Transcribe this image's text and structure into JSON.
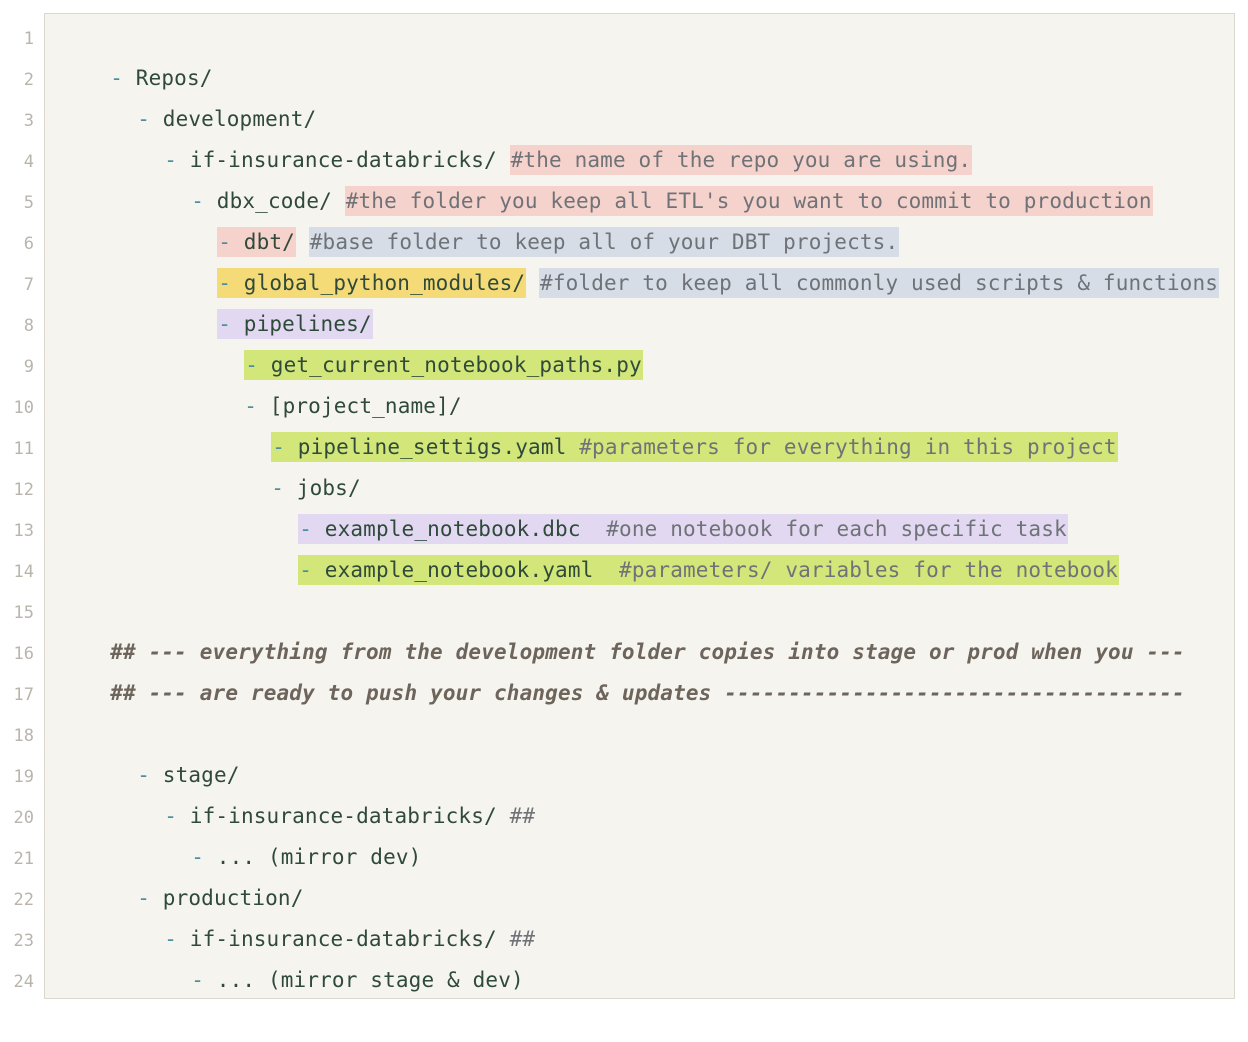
{
  "editor": {
    "line_numbers": [
      "1",
      "2",
      "3",
      "4",
      "5",
      "6",
      "7",
      "8",
      "9",
      "10",
      "11",
      "12",
      "13",
      "14",
      "15",
      "16",
      "17",
      "18",
      "19",
      "20",
      "21",
      "22",
      "23",
      "24"
    ],
    "lines": {
      "l1": {
        "dash": "- ",
        "text": "Repos/"
      },
      "l2": {
        "dash": "- ",
        "text": "development/"
      },
      "l3": {
        "dash": "- ",
        "text": "if-insurance-databricks/",
        "comment": "#the name of the repo you are using."
      },
      "l4": {
        "dash": "- ",
        "text": "dbx_code/",
        "comment": "#the folder you keep all ETL's you want to commit to production"
      },
      "l5": {
        "dash": "- ",
        "text": "dbt/",
        "comment": "#base folder to keep all of your DBT projects."
      },
      "l6": {
        "dash": "- ",
        "text": "global_python_modules/",
        "comment": "#folder to keep all commonly used scripts & functions"
      },
      "l7": {
        "dash": "- ",
        "text": "pipelines/"
      },
      "l8": {
        "dash": "- ",
        "text": "get_current_notebook_paths.py"
      },
      "l9": {
        "dash": "- ",
        "text": "[project_name]/"
      },
      "l10": {
        "dash": "- ",
        "text": "pipeline_settigs.yaml",
        "comment": "#parameters for everything in this project"
      },
      "l11": {
        "dash": "- ",
        "text": "jobs/"
      },
      "l12": {
        "dash": "- ",
        "text": "example_notebook.dbc",
        "comment": "#one notebook for each specific task"
      },
      "l13": {
        "dash": "- ",
        "text": "example_notebook.yaml",
        "comment": "#parameters/ variables for the notebook"
      },
      "l15": {
        "hash": "## ",
        "text": "--- everything from the development folder copies into stage or prod when you ---"
      },
      "l16": {
        "hash": "## ",
        "text": "--- are ready to push your changes & updates ------------------------------------"
      },
      "l18": {
        "dash": "- ",
        "text": "stage/"
      },
      "l19": {
        "dash": "- ",
        "text": "if-insurance-databricks/",
        "comment": "##"
      },
      "l20": {
        "dash": "- ",
        "text": "... (mirror dev)"
      },
      "l21": {
        "dash": "- ",
        "text": "production/"
      },
      "l22": {
        "dash": "- ",
        "text": "if-insurance-databricks/",
        "comment": "##"
      },
      "l23": {
        "dash": "- ",
        "text": "... (mirror stage & dev)"
      }
    }
  }
}
